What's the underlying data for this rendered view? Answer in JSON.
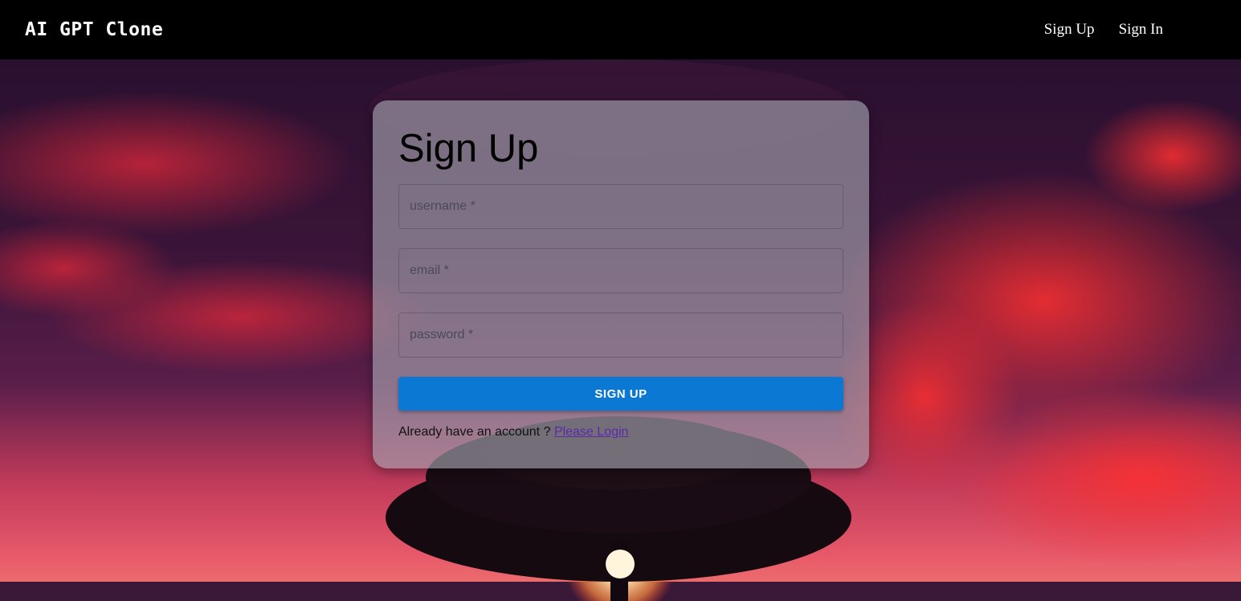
{
  "navbar": {
    "brand": "AI GPT Clone",
    "links": [
      {
        "label": "Sign Up"
      },
      {
        "label": "Sign In"
      }
    ]
  },
  "form": {
    "title": "Sign Up",
    "fields": [
      {
        "placeholder": "username *",
        "value": ""
      },
      {
        "placeholder": "email *",
        "value": ""
      },
      {
        "placeholder": "password *",
        "value": ""
      }
    ],
    "submit_label": "SIGN UP",
    "footer_text": "Already have an account ? ",
    "footer_link": "Please Login"
  },
  "colors": {
    "navbar_bg": "#000000",
    "button": "#0b78d3",
    "link": "#5a2aa8"
  }
}
